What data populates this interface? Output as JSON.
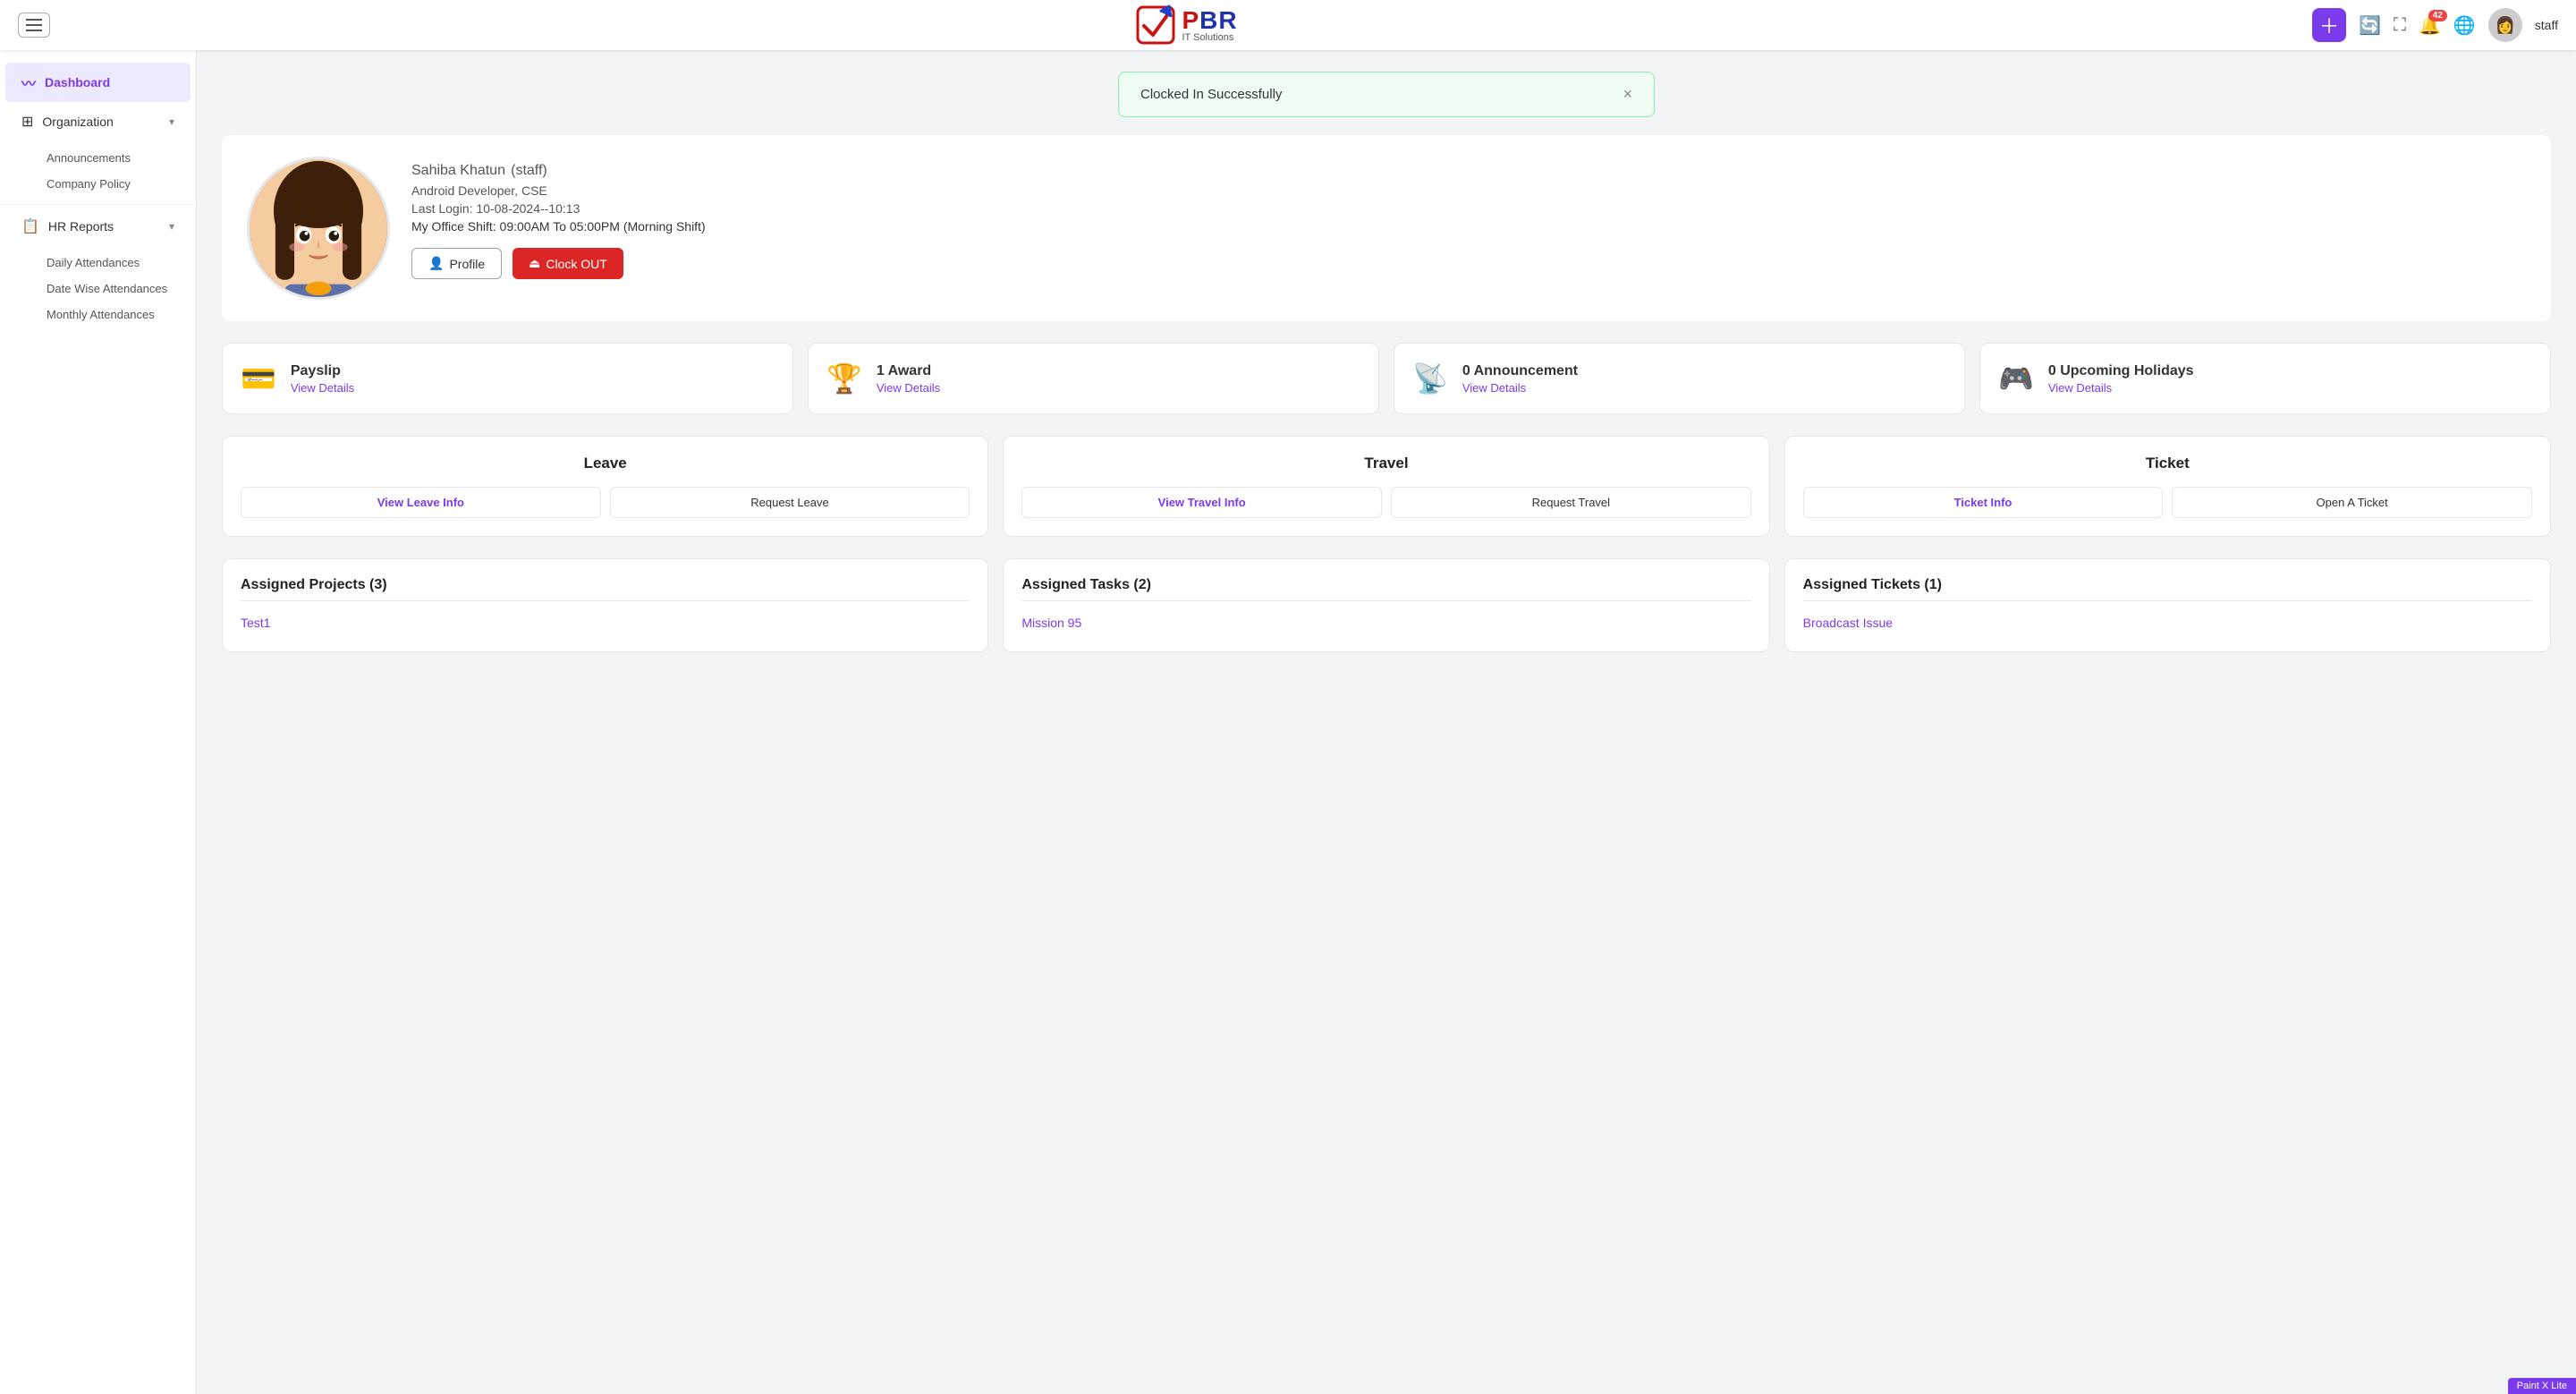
{
  "topnav": {
    "logo_pbr": "PBR",
    "logo_it": "IT Solutions",
    "notif_count": "42",
    "username": "staff"
  },
  "sidebar": {
    "dashboard_label": "Dashboard",
    "organization_label": "Organization",
    "announcements_label": "Announcements",
    "company_policy_label": "Company Policy",
    "hr_reports_label": "HR Reports",
    "daily_attendances_label": "Daily Attendances",
    "date_wise_label": "Date Wise Attendances",
    "monthly_label": "Monthly Attendances"
  },
  "toast": {
    "message": "Clocked In Successfully",
    "close_label": "×"
  },
  "profile": {
    "name": "Sahiba Khatun",
    "role_label": "(staff)",
    "department": "Android Developer, CSE",
    "last_login": "Last Login: 10-08-2024--10:13",
    "shift": "My Office Shift: 09:00AM To 05:00PM (Morning Shift)",
    "btn_profile": "Profile",
    "btn_clockout": "Clock OUT"
  },
  "stats": [
    {
      "id": "payslip",
      "icon": "💳",
      "icon_color": "#3b82f6",
      "label": "Payslip",
      "link": "View Details"
    },
    {
      "id": "award",
      "icon": "🏆",
      "icon_color": "#a855f7",
      "label": "1 Award",
      "link": "View Details"
    },
    {
      "id": "announcement",
      "icon": "📡",
      "icon_color": "#f97316",
      "label": "0 Announcement",
      "link": "View Details"
    },
    {
      "id": "holiday",
      "icon": "🎮",
      "icon_color": "#22c55e",
      "label": "0 Upcoming Holidays",
      "link": "View Details"
    }
  ],
  "actions": [
    {
      "id": "leave",
      "title": "Leave",
      "btn1_label": "View Leave Info",
      "btn2_label": "Request Leave"
    },
    {
      "id": "travel",
      "title": "Travel",
      "btn1_label": "View Travel Info",
      "btn2_label": "Request Travel"
    },
    {
      "id": "ticket",
      "title": "Ticket",
      "btn1_label": "Ticket Info",
      "btn2_label": "Open A Ticket"
    }
  ],
  "assigned": [
    {
      "id": "projects",
      "title": "Assigned Projects (3)",
      "items": [
        "Test1"
      ]
    },
    {
      "id": "tasks",
      "title": "Assigned Tasks (2)",
      "items": [
        "Mission 95"
      ]
    },
    {
      "id": "tickets",
      "title": "Assigned Tickets (1)",
      "items": [
        "Broadcast Issue"
      ]
    }
  ],
  "paintx": "Paint X Lite"
}
